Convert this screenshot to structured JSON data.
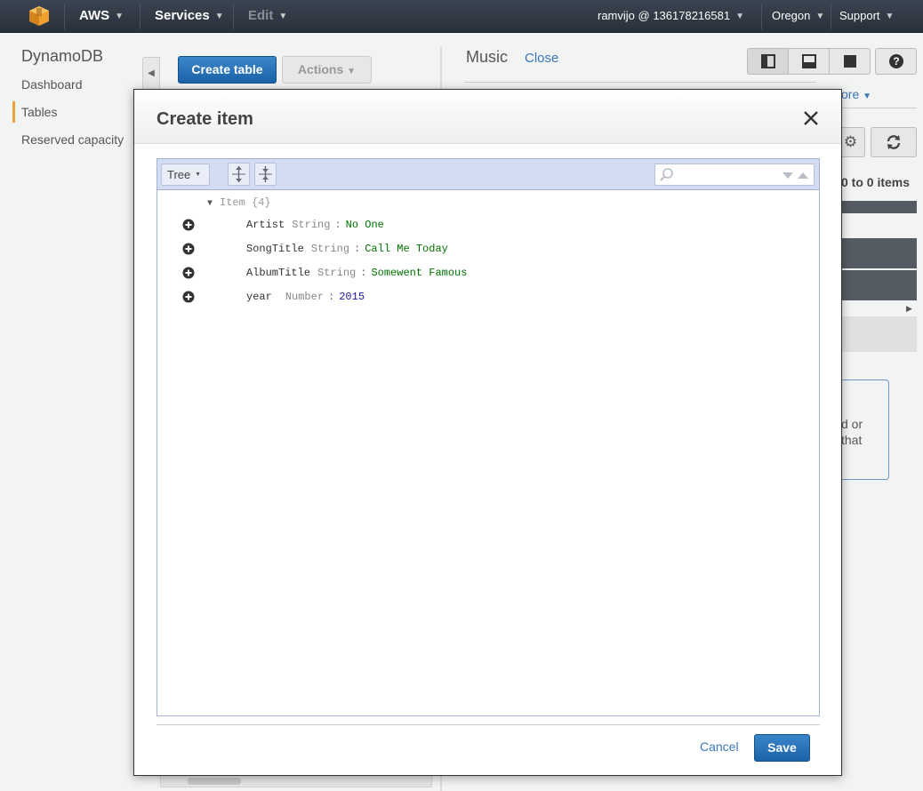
{
  "topnav": {
    "logo_icon": "aws-cube-icon",
    "aws_label": "AWS",
    "services_label": "Services",
    "edit_label": "Edit",
    "account_label": "ramvijo @ 136178216581",
    "region_label": "Oregon",
    "support_label": "Support"
  },
  "sidebar": {
    "title": "DynamoDB",
    "items": [
      {
        "label": "Dashboard"
      },
      {
        "label": "Tables"
      },
      {
        "label": "Reserved capacity"
      }
    ],
    "active_accent": "#e8a23a"
  },
  "toolbar": {
    "create_table_label": "Create table",
    "actions_label": "Actions"
  },
  "detail_panel": {
    "table_name": "Music",
    "close_label": "Close",
    "more_label": "ore",
    "range_text": "0 to 0 items",
    "info_text_1": "d or",
    "info_text_2": "that"
  },
  "modal": {
    "title": "Create item",
    "mode_label": "Tree",
    "search_placeholder": "",
    "root_label": "Item {4}",
    "fields": [
      {
        "name": "Artist",
        "type": "String",
        "value": "No One",
        "kind": "string"
      },
      {
        "name": "SongTitle",
        "type": "String",
        "value": "Call Me Today",
        "kind": "string"
      },
      {
        "name": "AlbumTitle",
        "type": "String",
        "value": "Somewent Famous",
        "kind": "string"
      },
      {
        "name": "year",
        "type": "Number",
        "value": "2015",
        "kind": "number"
      }
    ],
    "cancel_label": "Cancel",
    "save_label": "Save"
  },
  "colors": {
    "primary_button": "#1b62a8",
    "link": "#3a78b8",
    "string_value": "#007200",
    "number_value": "#1a1aa6",
    "editor_toolbar": "#d4dcf2"
  }
}
